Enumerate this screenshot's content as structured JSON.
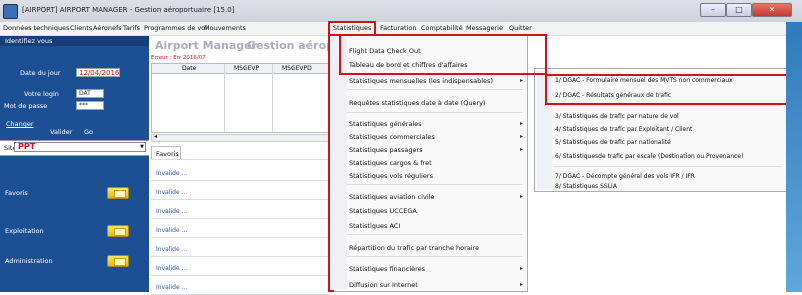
{
  "window": {
    "title": "[AIRPORT] AIRPORT MANAGER - Gestion aéroportuaire [15.0]",
    "buttons": [
      "–",
      "□",
      "✕"
    ]
  },
  "menubar": [
    "Données techniques",
    "Clients",
    "Aéronefs",
    "Tarifs",
    "Programmes de vol",
    "Mouvements",
    "Statistiques",
    "Facturation",
    "Comptabilité",
    "Messagerie",
    "Quitter"
  ],
  "left_panel": {
    "title": "Identifiez vous",
    "date_label": "Date du jour",
    "date_value": "12/04/2016",
    "login_label": "Votre login",
    "login_value": "DAT",
    "password_label": "Mot de passe",
    "password_value": "***",
    "change_label": "Changer",
    "validate_label": "Valider",
    "validate_suffix": "Go",
    "site_label": "Site",
    "site_value": "PPT",
    "sections": [
      "Favoris",
      "Exploitation",
      "Administration"
    ]
  },
  "main": {
    "app_name": "Airport Manager",
    "app_subtitle": "Gestion aéropo",
    "error_text": "Erreur : Err 2016/07",
    "columns": [
      "Date",
      "MSGEVP",
      "MSGEVPD"
    ],
    "favoris_tab": "Favoris",
    "row_link": "Invalide ..."
  },
  "statistiques_menu": {
    "items": [
      {
        "label": "Flight Data Check Out",
        "sub": false
      },
      {
        "label": "Tableau de bord et chiffres d'affaires",
        "sub": false
      },
      {
        "label": "Statistiques mensuelles (les indispensables)",
        "sub": true
      },
      {
        "label": "Requêtes statistiques date à date (Query)",
        "sub": false
      },
      {
        "label": "Statistiques générales",
        "sub": true
      },
      {
        "label": "Statistiques commerciales",
        "sub": true
      },
      {
        "label": "Statistiques passagers",
        "sub": true
      },
      {
        "label": "Statistiques cargos & fret",
        "sub": false
      },
      {
        "label": "Statistiques vols réguliers",
        "sub": false
      },
      {
        "label": "Statistiques aviation civile",
        "sub": true
      },
      {
        "label": "Statistiques UCCEGA",
        "sub": false
      },
      {
        "label": "Statistiques ACI",
        "sub": false
      },
      {
        "label": "Répartition du trafic par tranche horaire",
        "sub": false
      },
      {
        "label": "Statistiques financières",
        "sub": true
      },
      {
        "label": "Diffusion sur Internet",
        "sub": true
      }
    ]
  },
  "submenu": {
    "items": [
      "1/ DGAC - Formulaire mensuel des MVTS non commerciaux",
      "2/ DGAC - Résultats généraux de trafic",
      "3/ Statistiques de trafic par nature de vol",
      "4/ Statistiques de trafic par Exploitant / Client",
      "5/ Statistiques de trafic par nationalité",
      "6/ Statistiquesde trafic par escale (Destination ou Provenance)",
      "7/ DGAC - Décompte général des vols IFR / IFR",
      "8/ Statistiques SSLIA"
    ]
  },
  "colors": {
    "accent_red": "#d80f1b",
    "left_panel_blue": "#1d4f95",
    "link_blue": "#2b55a8"
  }
}
